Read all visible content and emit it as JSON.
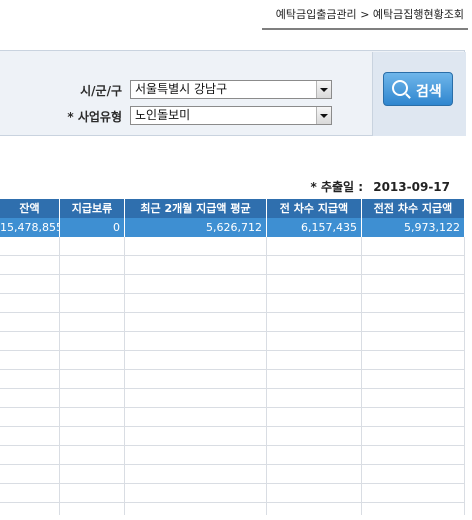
{
  "breadcrumb": {
    "parent": "예탁금입출금관리",
    "separator": ">",
    "current": "예탁금집행현황조회"
  },
  "filters": {
    "region_label": "시/군/구",
    "region_value": "서울특별시 강남구",
    "business_label": "* 사업유형",
    "business_value": "노인돌보미"
  },
  "search_button": {
    "label": "검색"
  },
  "extract": {
    "label": "* 추출일 :",
    "date": "2013-09-17"
  },
  "table": {
    "headers": [
      "잔액",
      "지급보류",
      "최근 2개월 지급액 평균",
      "전 차수 지급액",
      "전전 차수 지급액"
    ],
    "rows": [
      [
        "15,478,855",
        "0",
        "5,626,712",
        "6,157,435",
        "5,973,122"
      ]
    ]
  }
}
